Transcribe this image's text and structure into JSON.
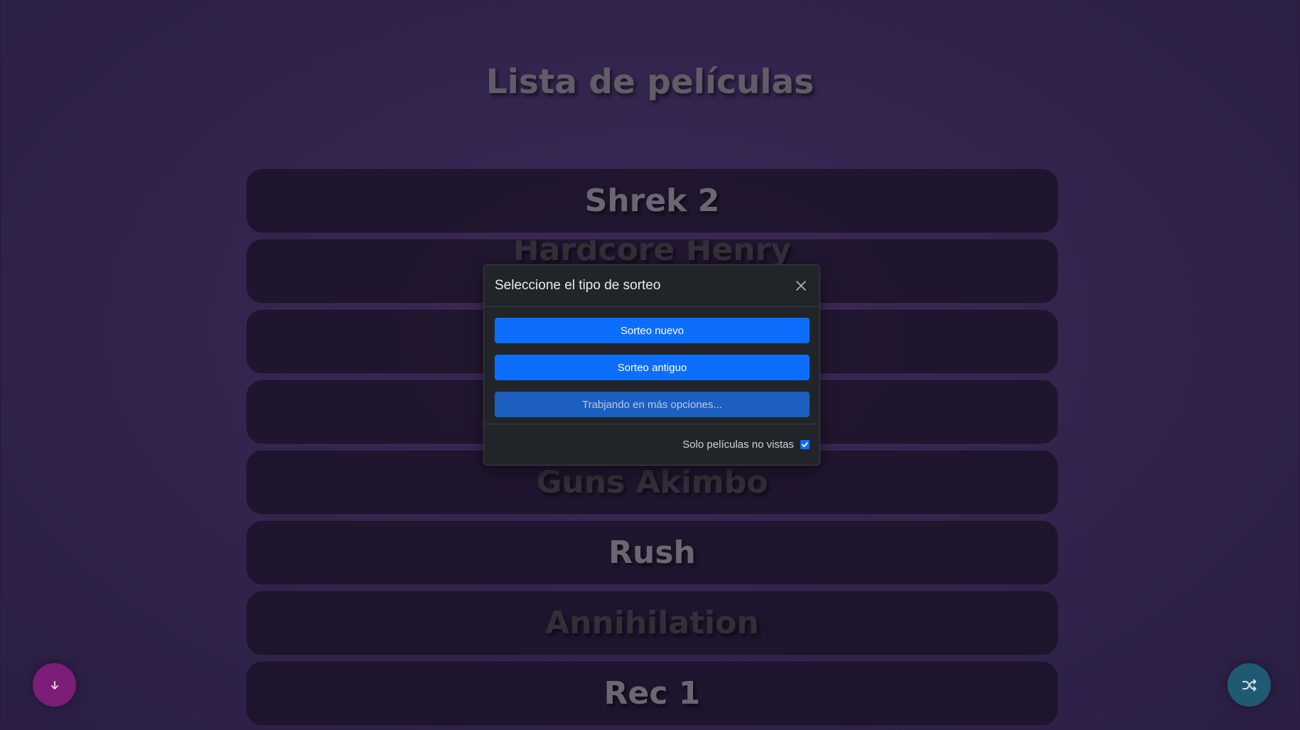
{
  "page": {
    "title": "Lista de películas"
  },
  "movies": [
    {
      "title": "Shrek 2",
      "state": "bright"
    },
    {
      "title": "Hardcore Henry",
      "state": "partial"
    },
    {
      "title": "",
      "state": "hidden"
    },
    {
      "title": "",
      "state": "hidden"
    },
    {
      "title": "Guns Akimbo",
      "state": "watched"
    },
    {
      "title": "Rush",
      "state": "bright"
    },
    {
      "title": "Annihilation",
      "state": "watched"
    },
    {
      "title": "Rec 1",
      "state": "bright"
    }
  ],
  "modal": {
    "title": "Seleccione el tipo de sorteo",
    "close_icon": "close-icon",
    "options": [
      {
        "label": "Sorteo nuevo",
        "enabled": true
      },
      {
        "label": "Sorteo antiguo",
        "enabled": true
      },
      {
        "label": "Trabjando en más opciones...",
        "enabled": false
      }
    ],
    "footer": {
      "checkbox_label": "Solo películas no vistas",
      "checked": true
    }
  },
  "fabs": {
    "download_icon": "arrow-down-icon",
    "shuffle_icon": "shuffle-icon"
  },
  "colors": {
    "primary": "#0d6efd",
    "modal_bg": "#212529",
    "fab_download": "#7c1d77",
    "fab_shuffle": "#1f5a72"
  }
}
